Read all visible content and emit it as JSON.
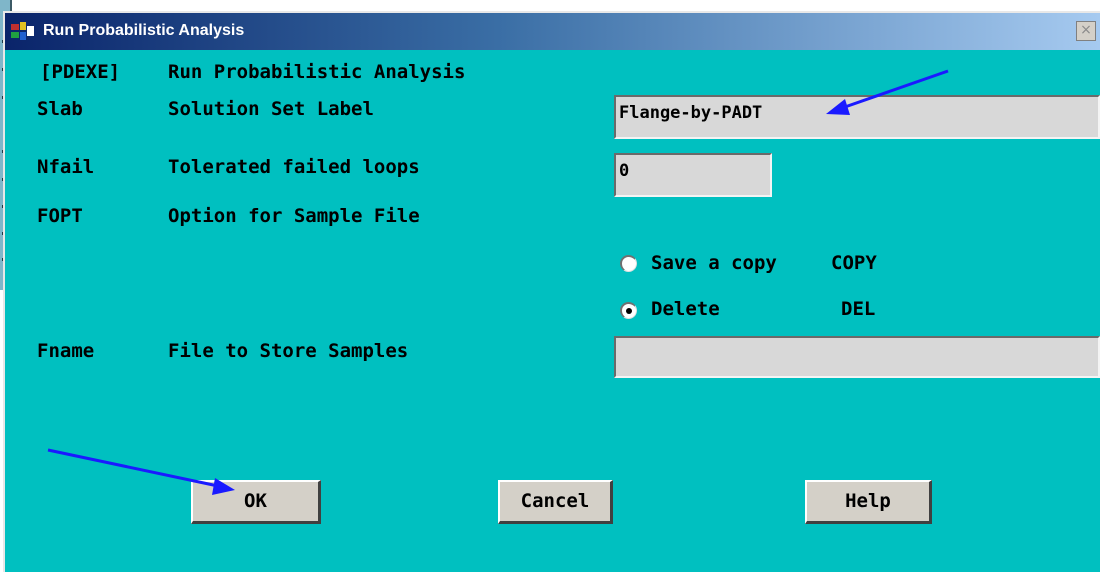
{
  "dialog": {
    "title": "Run Probabilistic Analysis",
    "close_glyph": "×"
  },
  "rows": [
    {
      "code": "[PDEXE]",
      "label": "Run Probabilistic Analysis"
    },
    {
      "code": "Slab",
      "label": "Solution Set Label"
    },
    {
      "code": "Nfail",
      "label": "Tolerated failed loops"
    },
    {
      "code": "FOPT",
      "label": "Option for Sample File"
    },
    {
      "code": "Fname",
      "label": "File to Store Samples"
    }
  ],
  "fields": {
    "slab_value": "Flange-by-PADT",
    "nfail_value": "0",
    "fname_value": ""
  },
  "fopt_options": [
    {
      "label": "Save a copy",
      "code": "COPY",
      "selected": false
    },
    {
      "label": "Delete",
      "code": "DEL",
      "selected": true
    }
  ],
  "buttons": {
    "ok": "OK",
    "cancel": "Cancel",
    "help": "Help"
  },
  "colors": {
    "dialog_background": "#00c0c0",
    "title_bar_start": "#0a246a",
    "annotation_arrow": "#1a1aff"
  },
  "icons": {
    "app": "ansys-app-icon",
    "close": "close-icon",
    "annotation": "blue-arrow-icon"
  }
}
